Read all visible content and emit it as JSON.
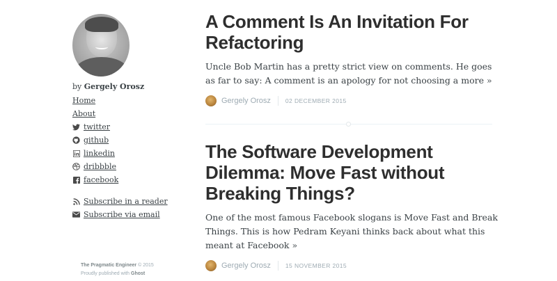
{
  "sidebar": {
    "by_prefix": "by",
    "author_name": "Gergely Orosz",
    "nav": [
      "Home",
      "About"
    ],
    "social": [
      {
        "icon": "twitter-icon",
        "label": "twitter"
      },
      {
        "icon": "github-icon",
        "label": "github"
      },
      {
        "icon": "linkedin-icon",
        "label": "linkedin"
      },
      {
        "icon": "dribbble-icon",
        "label": "dribbble"
      },
      {
        "icon": "facebook-icon",
        "label": "facebook"
      }
    ],
    "subscribe": [
      {
        "icon": "rss-icon",
        "label": "Subscribe in a reader"
      },
      {
        "icon": "email-icon",
        "label": "Subscribe via email"
      }
    ]
  },
  "footer": {
    "site_name": "The Pragmatic Engineer",
    "copyright": "© 2015",
    "published_prefix": "Proudly published with",
    "platform": "Ghost"
  },
  "posts": [
    {
      "title": "A Comment Is An Invitation For Refactoring",
      "excerpt": "Uncle Bob Martin has a pretty strict view on comments. He goes as far to say: A comment is an apology for not choosing a more »",
      "author": "Gergely Orosz",
      "date": "02 DECEMBER 2015"
    },
    {
      "title": "The Software Development Dilemma: Move Fast without Breaking Things?",
      "excerpt": "One of the most famous Facebook slogans is Move Fast and Break Things. This is how Pedram Keyani thinks back about what this meant at Facebook »",
      "author": "Gergely Orosz",
      "date": "15 NOVEMBER 2015"
    }
  ],
  "colors": {
    "text": "#3a4145",
    "title": "#2e2e2e",
    "meta": "#9eabb3",
    "divider": "#ebf2f6"
  }
}
